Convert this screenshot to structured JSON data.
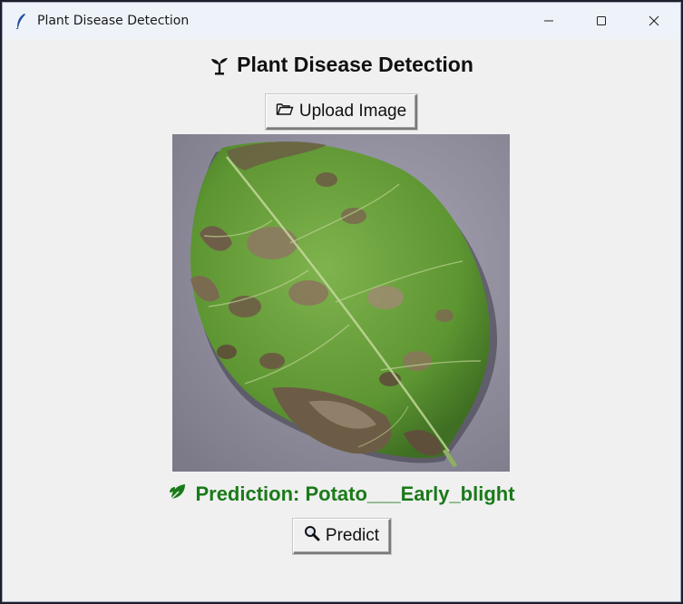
{
  "window": {
    "title": "Plant Disease Detection",
    "app_icon": "feather-icon",
    "controls": [
      "minimize-icon",
      "maximize-icon",
      "close-icon"
    ]
  },
  "main": {
    "heading": "Plant Disease Detection",
    "heading_icon": "seedling-icon",
    "upload_button": {
      "label": "Upload Image",
      "icon": "folder-open-icon"
    },
    "image": {
      "subject": "leaf-image"
    },
    "prediction": {
      "text": "Prediction: Potato___Early_blight",
      "icon": "leaf-icon",
      "color": "#1a7a1a"
    },
    "predict_button": {
      "label": "Predict",
      "icon": "magnifier-icon"
    }
  }
}
